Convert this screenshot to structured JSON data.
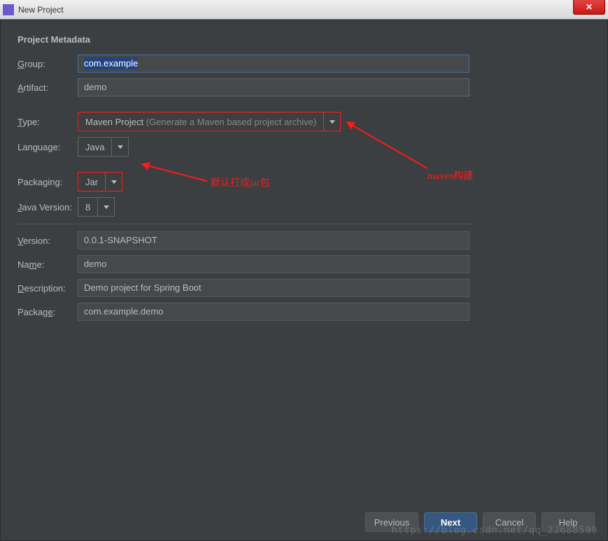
{
  "window": {
    "title": "New Project",
    "close_symbol": "✕"
  },
  "section_title": "Project Metadata",
  "labels": {
    "group": "Group:",
    "artifact": "Artifact:",
    "type": "Type:",
    "language": "Language:",
    "packaging": "Packaging:",
    "java_version": "Java Version:",
    "version": "Version:",
    "name": "Name:",
    "description": "Description:",
    "package": "Package:"
  },
  "fields": {
    "group": "com.example",
    "artifact": "demo",
    "type_value": "Maven Project",
    "type_hint": "(Generate a Maven based project archive)",
    "language": "Java",
    "packaging": "Jar",
    "java_version": "8",
    "version": "0.0.1-SNAPSHOT",
    "name": "demo",
    "description": "Demo project for Spring Boot",
    "package": "com.example.demo"
  },
  "annotations": {
    "jar_note": "默认打成jar包",
    "maven_note": "maven构建"
  },
  "buttons": {
    "previous": "Previous",
    "next": "Next",
    "cancel": "Cancel",
    "help": "Help"
  },
  "watermark": "https://blog.csdn.net/qq_22688599"
}
